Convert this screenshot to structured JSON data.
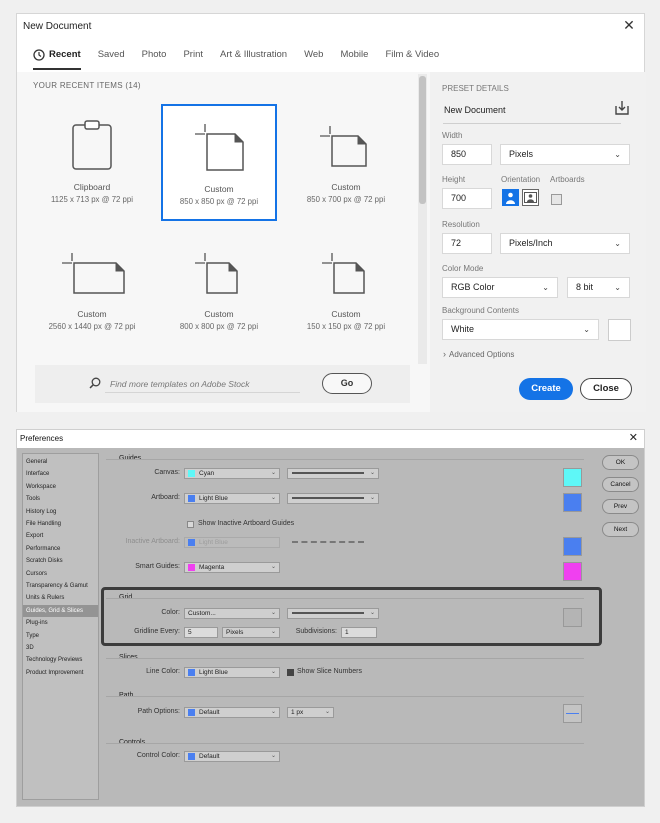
{
  "new_document": {
    "title": "New Document",
    "close_glyph": "✕",
    "tabs": [
      "Recent",
      "Saved",
      "Photo",
      "Print",
      "Art & Illustration",
      "Web",
      "Mobile",
      "Film & Video"
    ],
    "recent_heading": "YOUR RECENT ITEMS  (14)",
    "items": [
      {
        "name": "Clipboard",
        "size": "1125 x 713 px @ 72 ppi",
        "icon": "clipboard-icon"
      },
      {
        "name": "Custom",
        "size": "850 x 850 px @ 72 ppi",
        "icon": "document-icon"
      },
      {
        "name": "Custom",
        "size": "850 x 700 px @ 72 ppi",
        "icon": "document-icon"
      },
      {
        "name": "Custom",
        "size": "2560 x 1440 px @ 72 ppi",
        "icon": "document-icon"
      },
      {
        "name": "Custom",
        "size": "800 x 800 px @ 72 ppi",
        "icon": "document-icon"
      },
      {
        "name": "Custom",
        "size": "150 x 150 px @ 72 ppi",
        "icon": "document-icon"
      }
    ],
    "stock_placeholder": "Find more templates on Adobe Stock",
    "go_label": "Go",
    "preset": {
      "heading": "PRESET DETAILS",
      "name": "New Document",
      "width_label": "Width",
      "width": "850",
      "width_unit": "Pixels",
      "height_label": "Height",
      "height": "700",
      "orientation_label": "Orientation",
      "artboards_label": "Artboards",
      "resolution_label": "Resolution",
      "resolution": "72",
      "resolution_unit": "Pixels/Inch",
      "color_mode_label": "Color Mode",
      "color_mode": "RGB Color",
      "bit_depth": "8 bit",
      "background_label": "Background Contents",
      "background": "White",
      "advanced": "Advanced Options"
    },
    "create_label": "Create",
    "close_label": "Close"
  },
  "preferences": {
    "title": "Preferences",
    "close_glyph": "✕",
    "nav": [
      "General",
      "Interface",
      "Workspace",
      "Tools",
      "History Log",
      "File Handling",
      "Export",
      "Performance",
      "Scratch Disks",
      "Cursors",
      "Transparency & Gamut",
      "Units & Rulers",
      "Guides, Grid & Slices",
      "Plug-ins",
      "Type",
      "3D",
      "Technology Previews",
      "Product Improvement"
    ],
    "buttons": [
      "OK",
      "Cancel",
      "Prev",
      "Next"
    ],
    "guides": {
      "heading": "Guides",
      "canvas_label": "Canvas:",
      "canvas_color": "Cyan",
      "artboard_label": "Artboard:",
      "artboard_color": "Light Blue",
      "show_inactive": "Show Inactive Artboard Guides",
      "inactive_label": "Inactive Artboard:",
      "inactive_color": "Light Blue",
      "smart_label": "Smart Guides:",
      "smart_color": "Magenta"
    },
    "grid": {
      "heading": "Grid",
      "color_label": "Color:",
      "color": "Custom...",
      "gridline_label": "Gridline Every:",
      "gridline_value": "5",
      "gridline_unit": "Pixels",
      "subdivisions_label": "Subdivisions:",
      "subdivisions_value": "1"
    },
    "slices": {
      "heading": "Slices",
      "line_color_label": "Line Color:",
      "line_color": "Light Blue",
      "show_numbers": "Show Slice Numbers"
    },
    "path": {
      "heading": "Path",
      "options_label": "Path Options:",
      "options_color": "Default",
      "width": "1 px"
    },
    "controls": {
      "heading": "Controls",
      "color_label": "Control Color:",
      "color": "Default"
    }
  },
  "colors": {
    "accent": "#1473e6",
    "cyan": "#5ef7f7",
    "light_blue": "#4a7ff0",
    "magenta": "#f040f0",
    "grid_custom": "#b4b4b4"
  }
}
